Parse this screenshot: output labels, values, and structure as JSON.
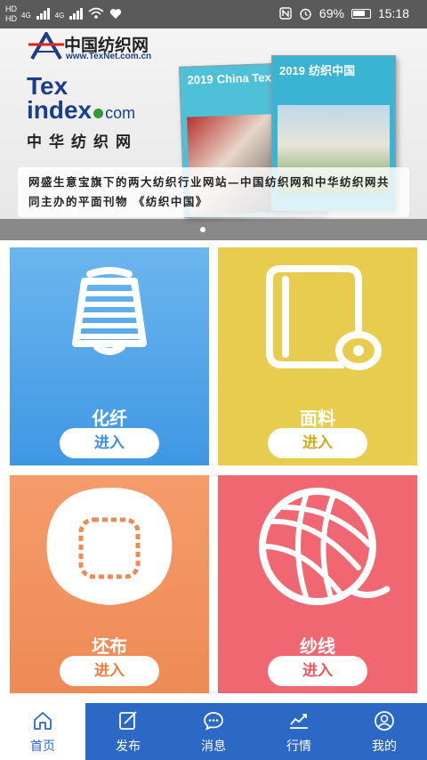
{
  "status_bar": {
    "sim1": "HD",
    "sim2": "HD",
    "net1": "4G",
    "net2": "4G",
    "battery": "69%",
    "time": "15:18"
  },
  "banner": {
    "logo_title": "中国纺织网",
    "logo_url": "www.TexNet.com.cn",
    "texindex_tex": "Tex",
    "texindex_index": "index",
    "texindex_com": "com",
    "texindex_cn": "中华纺织网",
    "mag1_year": "2019",
    "mag1_title": "China Textile",
    "mag2_year": "2019",
    "mag2_title": "纺织中国",
    "caption": "网盛生意宝旗下的两大纺织行业网站—中国纺织网和中华纺织网共同主办的平面刊物 《纺织中国》",
    "slide_count": 3,
    "active_slide": 1
  },
  "categories": [
    {
      "name": "化纤",
      "enter": "进入",
      "icon": "yarn-spool-icon",
      "color": "#4a9fe8"
    },
    {
      "name": "面料",
      "enter": "进入",
      "icon": "fabric-roll-icon",
      "color": "#e8cc4e"
    },
    {
      "name": "坯布",
      "enter": "进入",
      "icon": "cloth-patch-icon",
      "color": "#f1925e"
    },
    {
      "name": "纱线",
      "enter": "进入",
      "icon": "yarn-ball-icon",
      "color": "#f06772"
    }
  ],
  "nav": [
    {
      "label": "首页",
      "icon": "home-icon",
      "active": true
    },
    {
      "label": "发布",
      "icon": "publish-icon",
      "active": false
    },
    {
      "label": "消息",
      "icon": "message-icon",
      "active": false
    },
    {
      "label": "行情",
      "icon": "market-chart-icon",
      "active": false
    },
    {
      "label": "我的",
      "icon": "profile-icon",
      "active": false
    }
  ],
  "colors": {
    "nav_blue": "#2c68c6"
  }
}
